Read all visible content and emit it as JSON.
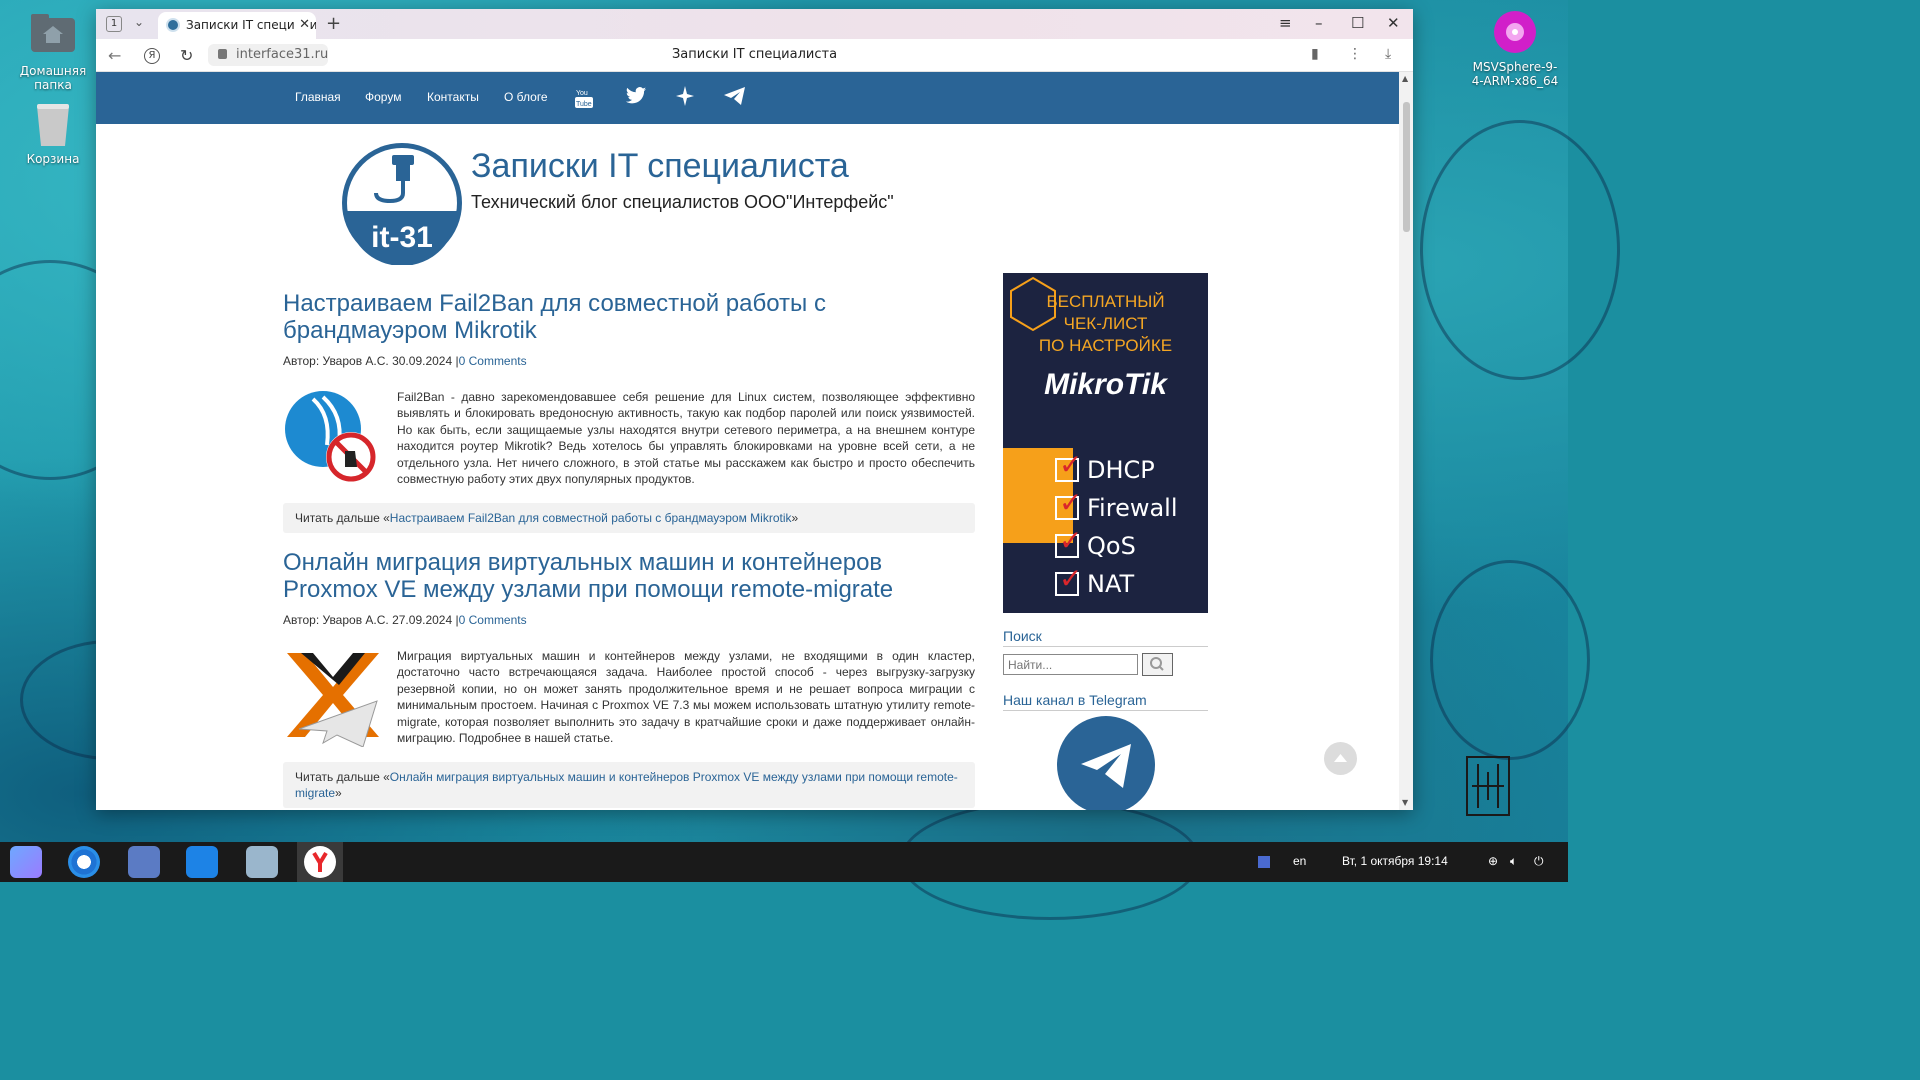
{
  "desktop": {
    "icons": [
      {
        "label": "Домашняя папка"
      },
      {
        "label": "Корзина"
      },
      {
        "label": "MSVSphere-9-4-ARM-x86_64"
      }
    ]
  },
  "browser": {
    "tab_count": "1",
    "tab_title": "Записки IT специалис",
    "url": "interface31.ru",
    "page_title": "Записки IT специалиста"
  },
  "site": {
    "nav": {
      "items": [
        {
          "label": "Главная"
        },
        {
          "label": "Форум"
        },
        {
          "label": "Контакты"
        },
        {
          "label": "О блоге"
        }
      ],
      "social_icons": [
        "youtube-icon",
        "twitter-icon",
        "sparkle-icon",
        "telegram-icon"
      ]
    },
    "logo_text": "it-31",
    "title": "Записки IT специалиста",
    "subtitle": "Технический блог специалистов ООО\"Интерфейс\"",
    "posts": [
      {
        "title": "Настраиваем Fail2Ban для совместной работы с брандмауэром Mikrotik",
        "meta": "Автор: Уваров А.С. 30.09.2024 |",
        "comments": "0 Comments",
        "text": "Fail2Ban - давно зарекомендовавшее себя решение для Linux систем, позволяющее эффективно выявлять и блокировать вредоносную активность, такую как подбор паролей или поиск уязвимостей. Но как быть, если защищаемые узлы находятся внутри сетевого периметра, а на внешнем контуре находится роутер Mikrotik? Ведь хотелось бы управлять блокировками на уровне всей сети, а не отдельного узла. Нет ничего сложного, в этой статье мы расскажем как быстро и просто обеспечить совместную работу этих двух популярных продуктов.",
        "readmore_prefix": "Читать дальше «",
        "readmore_link": "Настраиваем Fail2Ban для совместной работы с брандмауэром Mikrotik",
        "readmore_suffix": "»"
      },
      {
        "title": "Онлайн миграция виртуальных машин и контейнеров Proxmox VE между узлами при помощи remote-migrate",
        "meta": "Автор: Уваров А.С. 27.09.2024 |",
        "comments": "0 Comments",
        "text": "Миграция виртуальных машин и контейнеров между узлами, не входящими в один кластер, достаточно часто встречающаяся задача. Наиболее простой способ - через выгрузку-загрузку резервной копии, но он может занять продолжительное время и не решает вопроса миграции с минимальным простоем. Начиная с Proxmox VE 7.3 мы можем использовать штатную утилиту remote-migrate, которая позволяет выполнить это задачу в кратчайшие сроки и даже поддерживает онлайн-миграцию. Подробнее в нашей статье.",
        "readmore_prefix": "Читать дальше «",
        "readmore_link": "Онлайн миграция виртуальных машин и контейнеров Proxmox VE между узлами при помощи remote-migrate",
        "readmore_suffix": "»"
      }
    ],
    "banner": {
      "line1": "БЕСПЛАТНЫЙ",
      "line2": "ЧЕК-ЛИСТ",
      "line3": "ПО НАСТРОЙКЕ",
      "brand": "MikroTik",
      "checks": [
        "DHCP",
        "Firewall",
        "QoS",
        "NAT"
      ]
    },
    "sidebar": {
      "search_title": "Поиск",
      "search_placeholder": "Найти...",
      "telegram_title": "Наш канал в Telegram"
    }
  },
  "taskbar": {
    "apps": [
      "app-menu-icon",
      "chromium-icon",
      "mail-icon",
      "files-icon",
      "store-icon",
      "yandex-browser-icon"
    ],
    "lang": "en",
    "clock": "Вт, 1 октября 19:14"
  },
  "colors": {
    "accent": "#2a6496",
    "nav_bg": "#2a6496",
    "banner_bg": "#1c2340",
    "banner_orange": "#f6a01a"
  }
}
